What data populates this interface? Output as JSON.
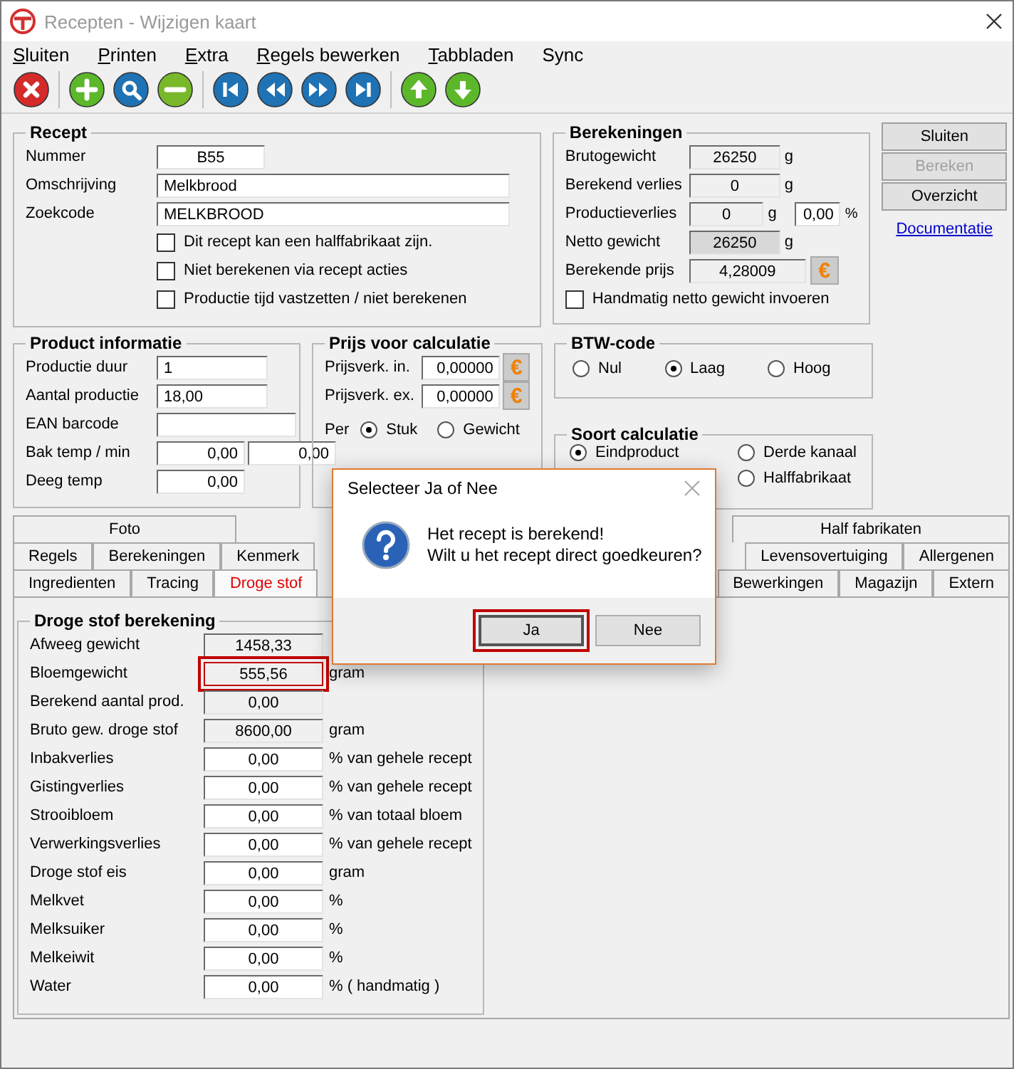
{
  "window": {
    "title": "Recepten - Wijzigen kaart"
  },
  "menu": [
    {
      "label": "Sluiten",
      "mnemonic": true
    },
    {
      "label": "Printen",
      "mnemonic": true
    },
    {
      "label": "Extra",
      "mnemonic": true
    },
    {
      "label": "Regels bewerken",
      "mnemonic": true
    },
    {
      "label": "Tabbladen",
      "mnemonic": true
    },
    {
      "label": "Sync",
      "mnemonic": false
    }
  ],
  "toolbar": [
    [
      {
        "kind": "close"
      }
    ],
    [
      {
        "kind": "add"
      },
      {
        "kind": "search"
      },
      {
        "kind": "remove"
      }
    ],
    [
      {
        "kind": "first"
      },
      {
        "kind": "prev"
      },
      {
        "kind": "next"
      },
      {
        "kind": "last"
      }
    ],
    [
      {
        "kind": "up"
      },
      {
        "kind": "down"
      }
    ]
  ],
  "recept": {
    "title": "Recept",
    "fields": [
      {
        "label": "Nummer",
        "value": "B55",
        "kind": "short"
      },
      {
        "label": "Omschrijving",
        "value": "Melkbrood",
        "kind": "wide"
      },
      {
        "label": "Zoekcode",
        "value": "MELKBROOD",
        "kind": "wide"
      }
    ],
    "checkboxes": [
      {
        "label": "Dit recept kan een halffabrikaat zijn.",
        "checked": false
      },
      {
        "label": "Niet berekenen via recept acties",
        "checked": false
      },
      {
        "label": "Productie tijd vastzetten / niet berekenen",
        "checked": false
      }
    ]
  },
  "berekeningen": {
    "title": "Berekeningen",
    "rows": [
      {
        "label": "Brutogewicht",
        "value": "26250",
        "unit": "g",
        "kind": "readonly"
      },
      {
        "label": "Berekend verlies",
        "value": "0",
        "unit": "g",
        "kind": "readonly"
      },
      {
        "label": "Productieverlies",
        "value": "0",
        "unit": "g",
        "kind": "percent",
        "percent": "0,00",
        "percent_unit": "%"
      },
      {
        "label": "Netto gewicht",
        "value": "26250",
        "unit": "g",
        "kind": "total"
      },
      {
        "label": "Berekende prijs",
        "value": "4,28009",
        "kind": "price",
        "button": "€"
      }
    ],
    "checkbox": {
      "label": "Handmatig netto gewicht invoeren",
      "checked": false
    }
  },
  "actions": [
    {
      "label": "Sluiten",
      "disabled": false
    },
    {
      "label": "Bereken",
      "disabled": true
    },
    {
      "label": "Overzicht",
      "disabled": false
    }
  ],
  "link": "Documentatie",
  "product_info": {
    "title": "Product informatie",
    "fields": [
      {
        "label": "Productie duur",
        "inputs": [
          {
            "value": "1",
            "kind": "medium"
          }
        ]
      },
      {
        "label": "Aantal productie",
        "inputs": [
          {
            "value": "18,00",
            "kind": "medium"
          }
        ]
      },
      {
        "label": "EAN barcode",
        "inputs": [
          {
            "kind": "wide"
          }
        ]
      },
      {
        "label": "Bak temp / min",
        "inputs": [
          {
            "value": "0,00",
            "kind": "half"
          },
          {
            "value": "0,00",
            "kind": "half"
          }
        ]
      },
      {
        "label": "Deeg temp",
        "inputs": [
          {
            "value": "0,00",
            "kind": "half"
          }
        ]
      }
    ]
  },
  "prijs": {
    "title": "Prijs voor calculatie",
    "rows": [
      {
        "label": "Prijsverk. in.",
        "value": "0,00000",
        "button": "€"
      },
      {
        "label": "Prijsverk. ex.",
        "value": "0,00000",
        "button": "€"
      }
    ],
    "per": {
      "label": "Per",
      "options": [
        {
          "label": "Stuk",
          "selected": true
        },
        {
          "label": "Gewicht",
          "selected": false
        }
      ]
    }
  },
  "btw": {
    "title": "BTW-code",
    "options": [
      {
        "label": "Nul",
        "selected": false
      },
      {
        "label": "Laag",
        "selected": true
      },
      {
        "label": "Hoog",
        "selected": false
      }
    ]
  },
  "soort": {
    "title": "Soort calculatie",
    "options": [
      {
        "label": "Eindproduct",
        "selected": true
      },
      {
        "label": "Derde kanaal",
        "selected": false
      },
      {
        "label": "Halffabrikaat",
        "selected": false
      }
    ]
  },
  "tab_rows": [
    {
      "left": [
        {
          "label": "Foto",
          "selected": false
        }
      ],
      "right": [
        {
          "label": "Half fabrikaten",
          "selected": false
        }
      ]
    },
    {
      "left": [
        {
          "label": "Regels",
          "selected": false
        },
        {
          "label": "Berekeningen",
          "selected": false
        },
        {
          "label": "Kenmerk",
          "selected": false
        }
      ],
      "right": [
        {
          "label": "Levensovertuiging",
          "selected": false
        },
        {
          "label": "Allergenen",
          "selected": false
        }
      ]
    },
    {
      "left": [
        {
          "label": "Ingredienten",
          "selected": false
        },
        {
          "label": "Tracing",
          "selected": false
        },
        {
          "label": "Droge stof",
          "selected": true
        }
      ],
      "right": [
        {
          "label": "Bewerkingen",
          "selected": false
        },
        {
          "label": "Magazijn",
          "selected": false
        },
        {
          "label": "Extern",
          "selected": false
        }
      ]
    }
  ],
  "droge_stof": {
    "title": "Droge stof berekening",
    "rows": [
      {
        "label": "Afweeg gewicht",
        "value": "1458,33",
        "kind": "readonly",
        "highlighted": false
      },
      {
        "label": "Bloemgewicht",
        "value": "555,56",
        "unit": "gram",
        "kind": "readonly",
        "highlighted": true
      },
      {
        "label": "Berekend aantal prod.",
        "value": "0,00",
        "kind": "readonly",
        "highlighted": false
      },
      {
        "label": "Bruto gew. droge stof",
        "value": "8600,00",
        "unit": "gram",
        "kind": "readonly",
        "highlighted": false
      },
      {
        "label": "Inbakverlies",
        "value": "0,00",
        "unit": "% van gehele recept",
        "kind": "input",
        "highlighted": false
      },
      {
        "label": "Gistingverlies",
        "value": "0,00",
        "unit": "% van gehele recept",
        "kind": "input",
        "highlighted": false
      },
      {
        "label": "Strooibloem",
        "value": "0,00",
        "unit": "% van totaal bloem",
        "kind": "input",
        "highlighted": false
      },
      {
        "label": "Verwerkingsverlies",
        "value": "0,00",
        "unit": "% van gehele recept",
        "kind": "input",
        "highlighted": false
      },
      {
        "label": "Droge stof eis",
        "value": "0,00",
        "unit": "gram",
        "kind": "input",
        "highlighted": false
      },
      {
        "label": "Melkvet",
        "value": "0,00",
        "unit": "%",
        "kind": "input",
        "highlighted": false
      },
      {
        "label": "Melksuiker",
        "value": "0,00",
        "unit": "%",
        "kind": "input",
        "highlighted": false
      },
      {
        "label": "Melkeiwit",
        "value": "0,00",
        "unit": "%",
        "kind": "input",
        "highlighted": false
      },
      {
        "label": "Water",
        "value": "0,00",
        "unit": "% ( handmatig )",
        "kind": "input",
        "highlighted": false
      }
    ]
  },
  "dialog": {
    "title": "Selecteer Ja of Nee",
    "message": "Het recept is berekend!\nWilt u het recept direct goedkeuren?",
    "buttons": [
      {
        "label": "Ja",
        "highlighted": true
      },
      {
        "label": "Nee",
        "highlighted": false
      }
    ]
  }
}
